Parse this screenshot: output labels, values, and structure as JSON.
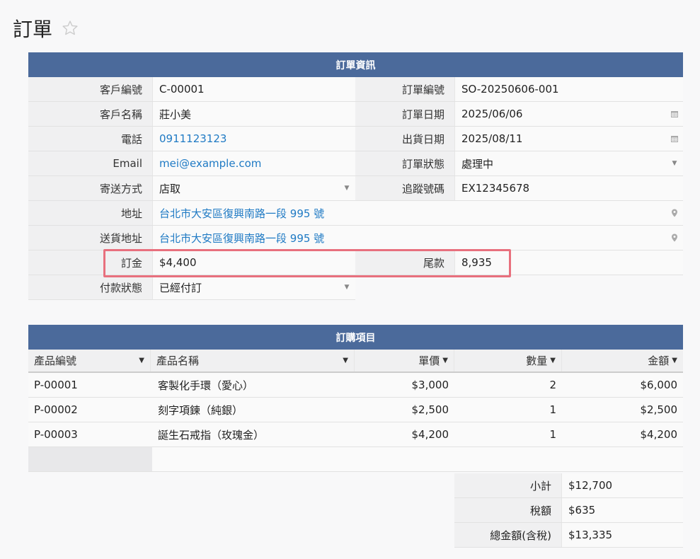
{
  "page": {
    "title": "訂單"
  },
  "order_info": {
    "header": "訂單資訊",
    "rows": [
      {
        "l1": "客戶編號",
        "v1": "C-00001",
        "l2": "訂單編號",
        "v2": "SO-20250606-001"
      },
      {
        "l1": "客戶名稱",
        "v1": "莊小美",
        "l2": "訂單日期",
        "v2": "2025/06/06"
      },
      {
        "l1": "電話",
        "v1": "0911123123",
        "l2": "出貨日期",
        "v2": "2025/08/11"
      },
      {
        "l1": "Email",
        "v1": "mei@example.com",
        "l2": "訂單狀態",
        "v2": "處理中"
      },
      {
        "l1": "寄送方式",
        "v1": "店取",
        "l2": "追蹤號碼",
        "v2": "EX12345678"
      },
      {
        "l1": "地址",
        "v1": "台北市大安區復興南路一段 995 號"
      },
      {
        "l1": "送貨地址",
        "v1": "台北市大安區復興南路一段 995 號"
      },
      {
        "l1": "訂金",
        "v1": "$4,400",
        "l2": "尾款",
        "v2": "8,935"
      },
      {
        "l1": "付款狀態",
        "v1": "已經付訂"
      }
    ]
  },
  "items": {
    "header": "訂購項目",
    "columns": [
      "產品編號",
      "產品名稱",
      "單價",
      "數量",
      "金額"
    ],
    "rows": [
      {
        "code": "P-00001",
        "name": "客製化手環（愛心）",
        "price": "$3,000",
        "qty": "2",
        "amount": "$6,000"
      },
      {
        "code": "P-00002",
        "name": "刻字項鍊（純銀）",
        "price": "$2,500",
        "qty": "1",
        "amount": "$2,500"
      },
      {
        "code": "P-00003",
        "name": "誕生石戒指（玫瑰金）",
        "price": "$4,200",
        "qty": "1",
        "amount": "$4,200"
      }
    ]
  },
  "totals": {
    "subtotal_label": "小計",
    "subtotal": "$12,700",
    "tax_label": "稅額",
    "tax": "$635",
    "total_label": "總金額(含稅)",
    "total": "$13,335"
  },
  "icons": {
    "favorite": "star-icon",
    "date": "calendar-icon",
    "dropdown": "chevron-down-icon",
    "location": "map-pin-icon",
    "sort": "sort-caret-icon"
  },
  "colors": {
    "header_bg": "#4b6a9b",
    "link": "#1f7ac4",
    "highlight": "#e8707e"
  }
}
